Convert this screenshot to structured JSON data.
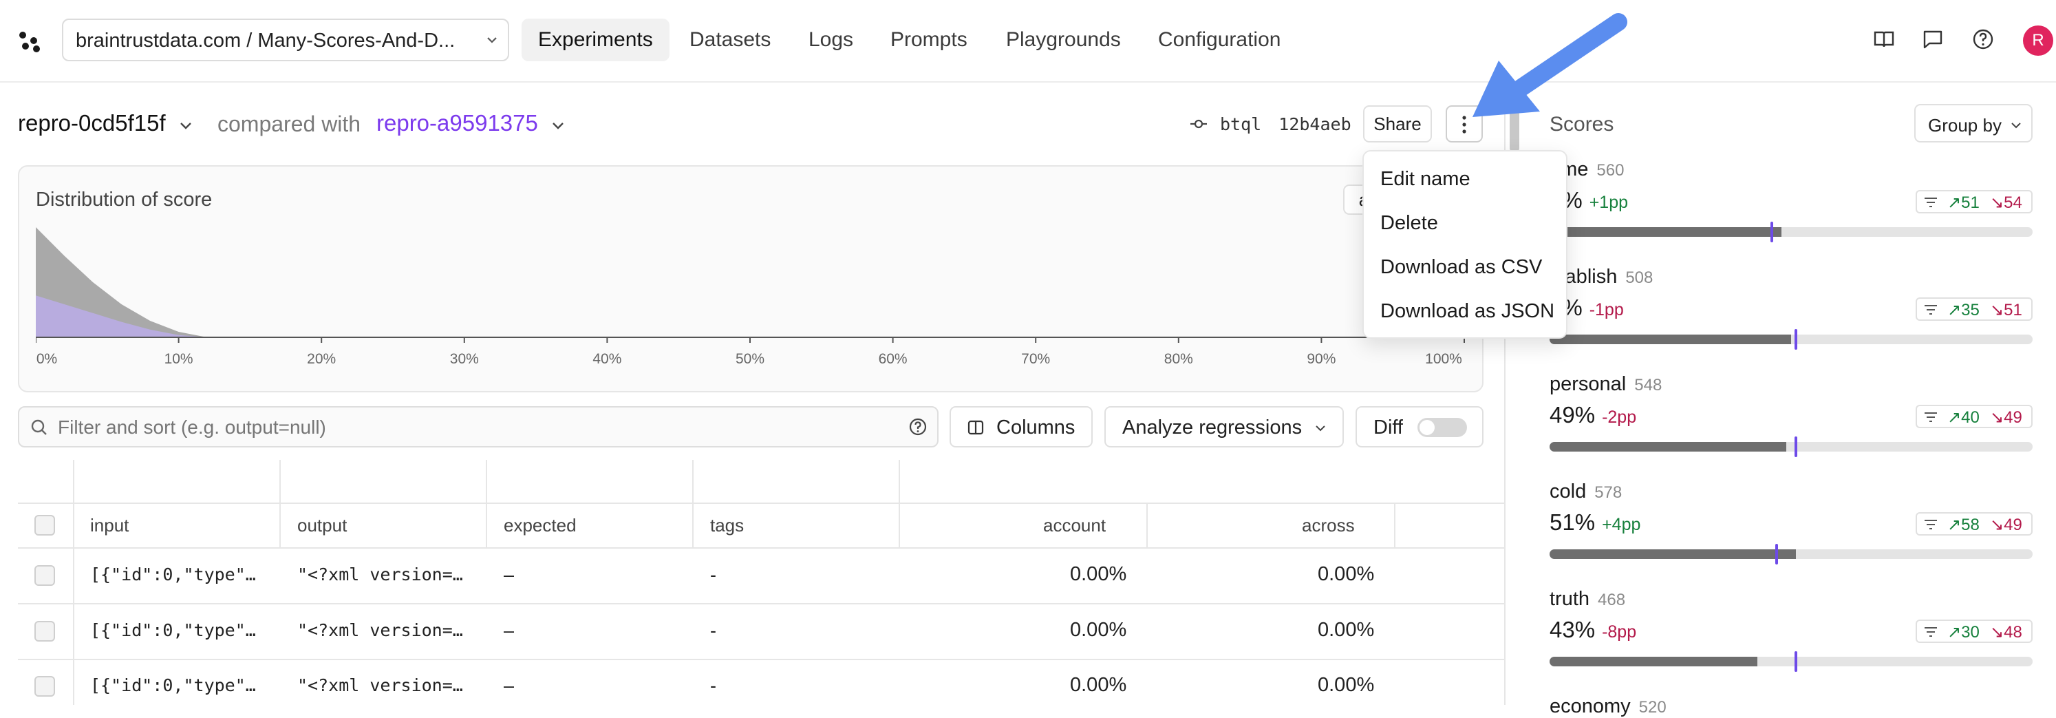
{
  "nav": {
    "project": "braintrustdata.com / Many-Scores-And-D...",
    "tabs": [
      "Experiments",
      "Datasets",
      "Logs",
      "Prompts",
      "Playgrounds",
      "Configuration"
    ],
    "avatar": "R"
  },
  "header": {
    "experiment": "repro-0cd5f15f",
    "compared_with": "compared with",
    "comparison": "repro-a9591375",
    "commit_label": "btql",
    "commit_hash": "12b4aeb",
    "share": "Share"
  },
  "menu": {
    "items": [
      "Edit name",
      "Delete",
      "Download as CSV",
      "Download as JSON"
    ]
  },
  "chart": {
    "title": "Distribution of score",
    "button_partial": "a"
  },
  "chart_data": {
    "type": "area",
    "title": "Distribution of score",
    "x_ticks": [
      "0%",
      "10%",
      "20%",
      "30%",
      "40%",
      "50%",
      "60%",
      "70%",
      "80%",
      "90%",
      "100%"
    ],
    "xlim": [
      0,
      100
    ],
    "series": [
      {
        "color": "#a9a9a9",
        "x": [
          0,
          2,
          4,
          6,
          8,
          10,
          12,
          95,
          100
        ],
        "y": [
          1.0,
          0.74,
          0.5,
          0.3,
          0.15,
          0.05,
          0,
          0,
          0.05
        ]
      },
      {
        "color": "#b8acdf",
        "x": [
          0,
          2,
          4,
          6,
          8,
          10,
          12,
          95,
          100
        ],
        "y": [
          0.38,
          0.3,
          0.22,
          0.14,
          0.07,
          0.02,
          0,
          0,
          0.05
        ]
      }
    ]
  },
  "toolbar": {
    "filter_placeholder": "Filter and sort (e.g. output=null)",
    "columns": "Columns",
    "analyze": "Analyze regressions",
    "diff": "Diff"
  },
  "table": {
    "headers": [
      "input",
      "output",
      "expected",
      "tags",
      "account",
      "across"
    ],
    "rows": [
      {
        "input": "[{\"id\":0,\"type\"…",
        "output": "\"<?xml version=…",
        "expected": "–",
        "tags": "-",
        "account": "0.00%",
        "across": "0.00%"
      },
      {
        "input": "[{\"id\":0,\"type\"…",
        "output": "\"<?xml version=…",
        "expected": "–",
        "tags": "-",
        "account": "0.00%",
        "across": "0.00%"
      },
      {
        "input": "[{\"id\":0,\"type\"…",
        "output": "\"<?xml version=…",
        "expected": "–",
        "tags": "-",
        "account": "0.00%",
        "across": "0.00%"
      }
    ]
  },
  "scores": {
    "title": "Scores",
    "group_by": "Group by",
    "items": [
      {
        "name": "ome",
        "count": "560",
        "value": "8%",
        "delta": "+1pp",
        "up": "51",
        "down": "54",
        "level": 0.48,
        "marker": 0.46
      },
      {
        "name": "stablish",
        "count": "508",
        "value": "0%",
        "delta": "-1pp",
        "up": "35",
        "down": "51",
        "level": 0.5,
        "marker": 0.51
      },
      {
        "name": "personal",
        "count": "548",
        "value": "49%",
        "delta": "-2pp",
        "up": "40",
        "down": "49",
        "level": 0.49,
        "marker": 0.51
      },
      {
        "name": "cold",
        "count": "578",
        "value": "51%",
        "delta": "+4pp",
        "up": "58",
        "down": "49",
        "level": 0.51,
        "marker": 0.47
      },
      {
        "name": "truth",
        "count": "468",
        "value": "43%",
        "delta": "-8pp",
        "up": "30",
        "down": "48",
        "level": 0.43,
        "marker": 0.51
      },
      {
        "name": "economy",
        "count": "520"
      }
    ]
  }
}
